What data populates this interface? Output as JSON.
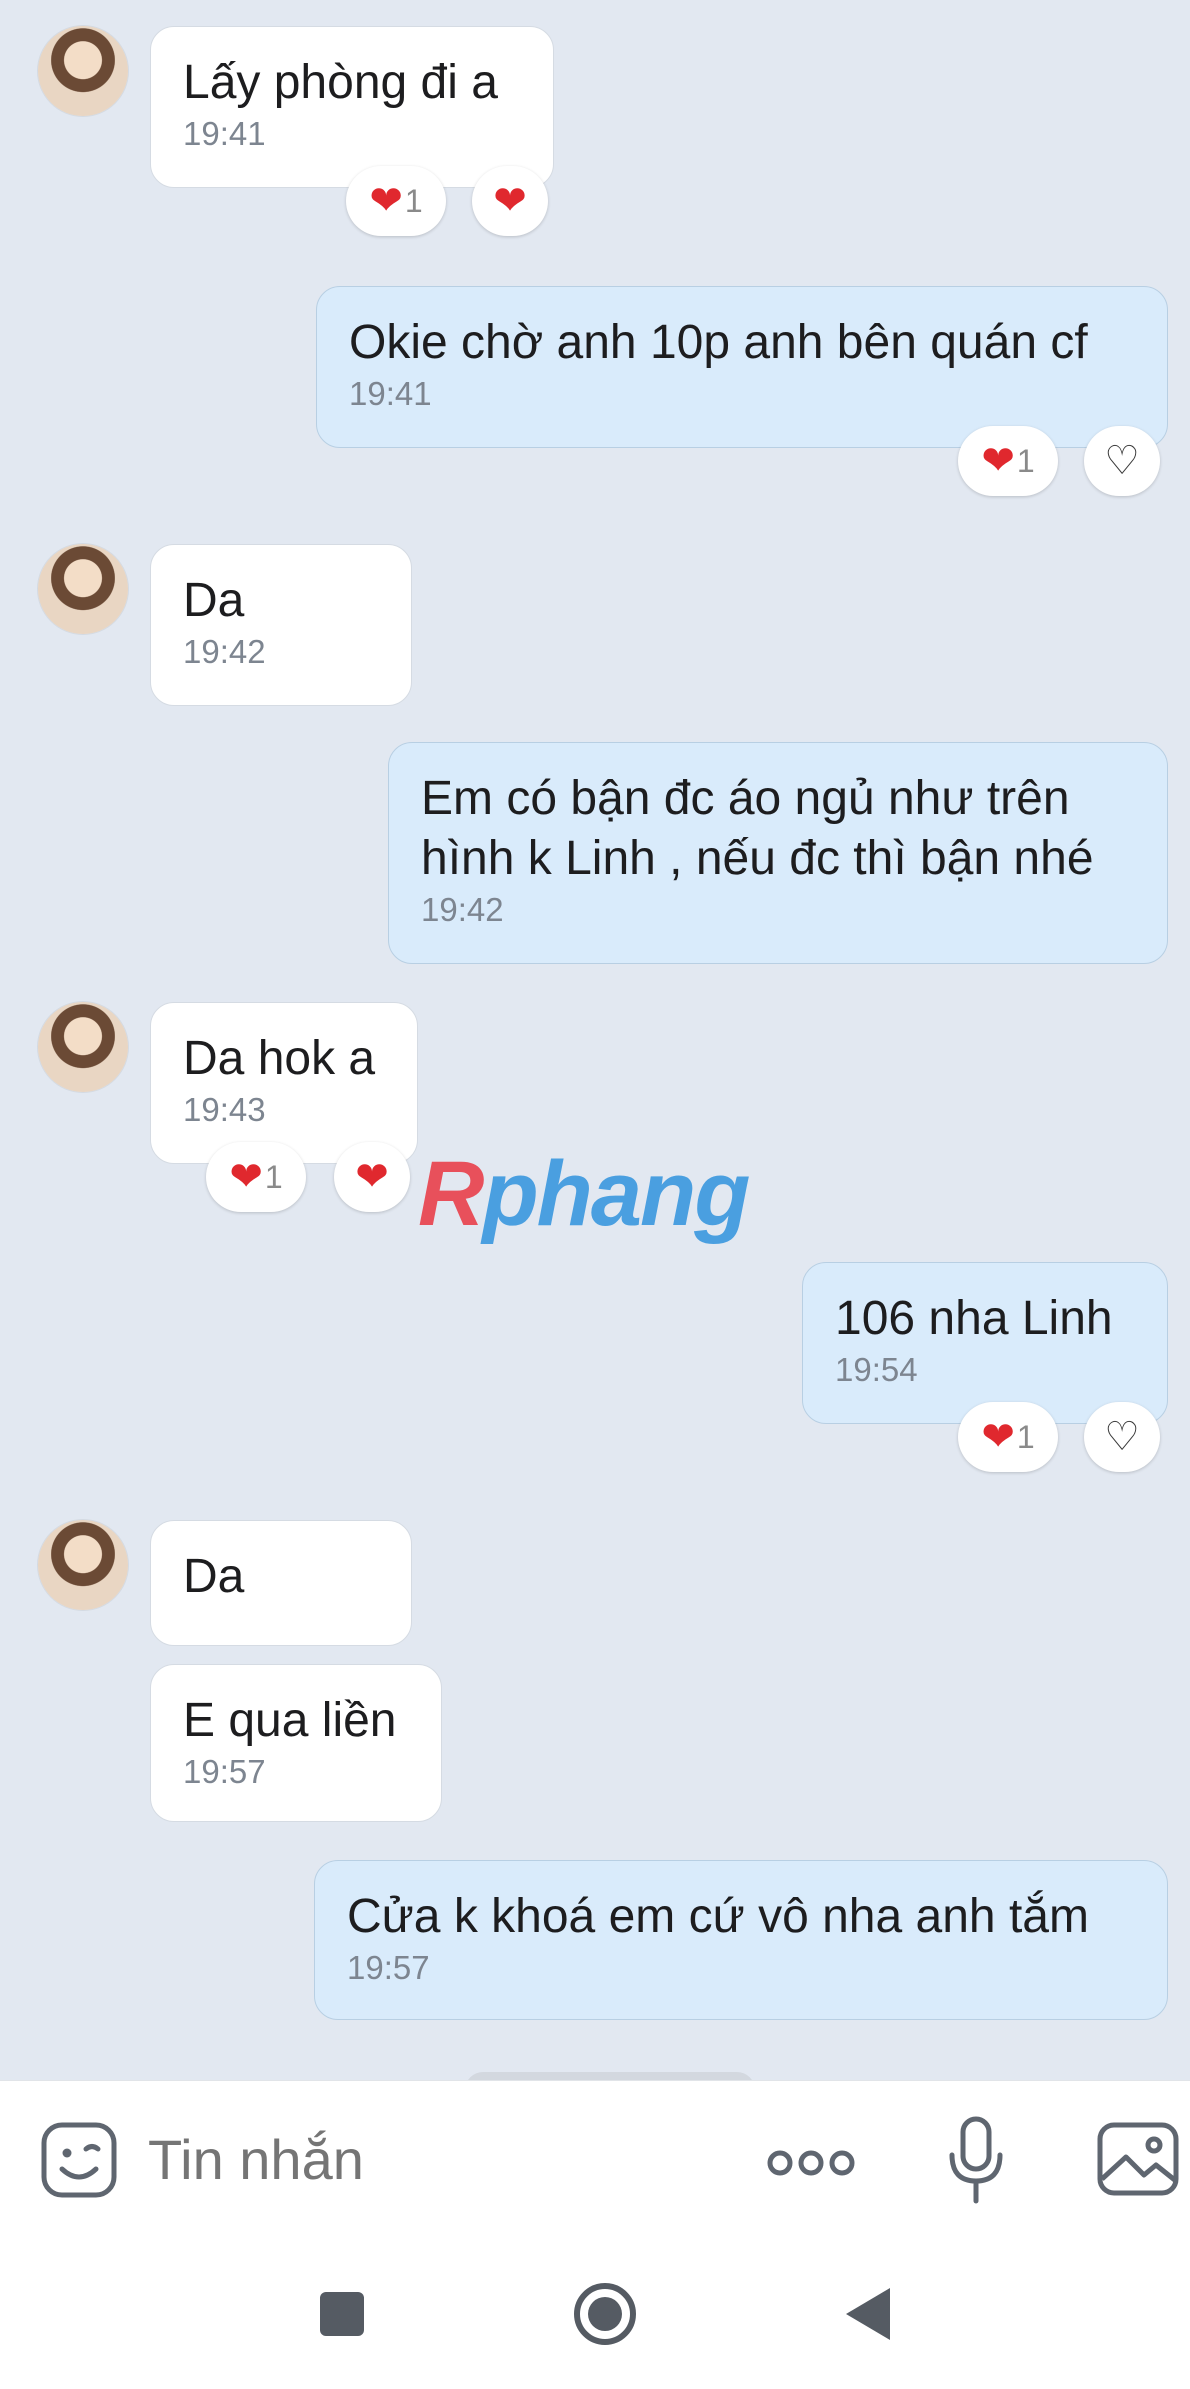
{
  "messages": [
    {
      "side": "in",
      "text": "Lấy phòng đi a",
      "time": "19:41",
      "reaction_count": "1"
    },
    {
      "side": "out",
      "text": "Okie chờ anh 10p anh bên quán cf",
      "time": "19:41",
      "reaction_count": "1"
    },
    {
      "side": "in",
      "text": "Da",
      "time": "19:42"
    },
    {
      "side": "out",
      "text_line1": "Em có bận đc áo ngủ như trên",
      "text_line2": "hình k Linh , nếu đc thì bận nhé",
      "time": "19:42"
    },
    {
      "side": "in",
      "text": "Da hok a",
      "time": "19:43",
      "reaction_count": "1"
    },
    {
      "side": "out",
      "text": "106 nha Linh",
      "time": "19:54",
      "reaction_count": "1"
    },
    {
      "side": "in",
      "text": "Da"
    },
    {
      "side": "in",
      "text": "E qua liền",
      "time": "19:57"
    },
    {
      "side": "out",
      "text": "Cửa k khoá em cứ vô nha anh tắm",
      "time": "19:57"
    }
  ],
  "watermark": {
    "first": "R",
    "rest": "phang"
  },
  "composer": {
    "placeholder": "Tin nhắn"
  },
  "icons": {
    "reaction": "heart-icon",
    "reaction_add": "heart-outline-icon",
    "sticker": "sticker-icon",
    "more": "more-icon",
    "mic": "microphone-icon",
    "image": "image-icon",
    "nav_recent": "square-icon",
    "nav_home": "circle-icon",
    "nav_back": "back-triangle-icon"
  },
  "colors": {
    "background": "#e2e8f1",
    "incoming_bubble": "#ffffff",
    "outgoing_bubble": "#d9ebfb",
    "heart": "#e0282e"
  }
}
